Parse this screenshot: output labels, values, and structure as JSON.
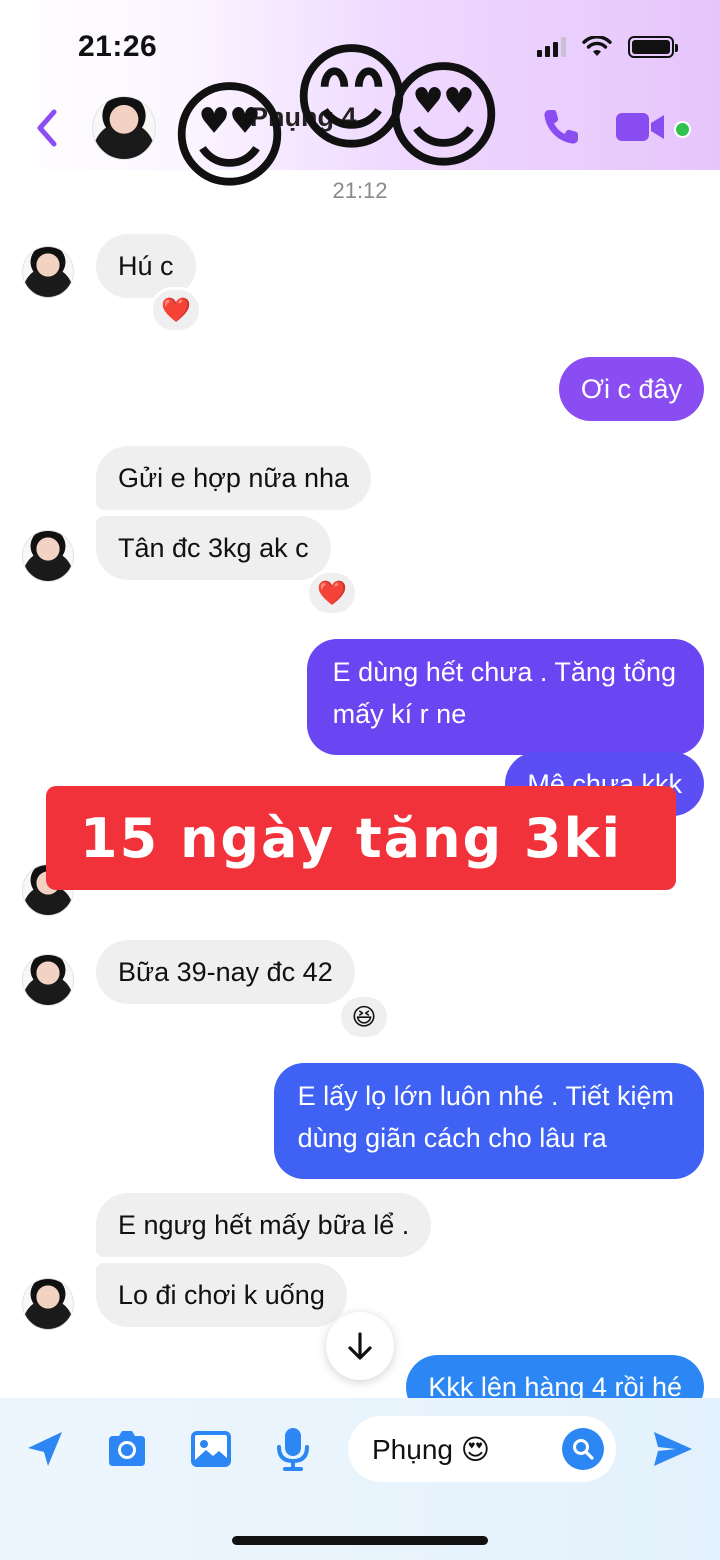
{
  "status_bar": {
    "time": "21:26",
    "icons": [
      "signal-icon",
      "wifi-icon",
      "battery-icon"
    ]
  },
  "header": {
    "contact_name": "Phụng 4",
    "contact_status": "",
    "icons": [
      "back-icon",
      "avatar",
      "phone-icon",
      "video-camera-icon"
    ],
    "online": true,
    "stickers": [
      "😍",
      "😊",
      "😍"
    ]
  },
  "timestamp": "21:12",
  "messages": [
    {
      "from": "them",
      "text": "Hú c",
      "reaction": "❤️"
    },
    {
      "from": "me",
      "text": "Ơi c đây"
    },
    {
      "from": "them",
      "text": "Gửi e hợp nữa nha"
    },
    {
      "from": "them",
      "text": "Tân đc 3kg ak c",
      "reaction": "❤️"
    },
    {
      "from": "me",
      "text_line1": "E dùng hết chưa . Tăng tổng",
      "text_line2": "mấy kí r ne"
    },
    {
      "from": "me",
      "text": "Mê chưa kkk"
    },
    {
      "from": "them",
      "text": "🤣"
    },
    {
      "from": "them",
      "text": "Bữa 39-nay đc 42",
      "reaction": "😆"
    },
    {
      "from": "me",
      "text_line1": "E lấy lọ lớn luôn nhé . Tiết kiệm",
      "text_line2": "dùng giãn cách cho lâu ra"
    },
    {
      "from": "them",
      "text": "E ngưg hết mấy bữa lể ."
    },
    {
      "from": "them",
      "text": "Lo đi chơi k uống"
    },
    {
      "from": "me",
      "text": "Kkk lên hàng 4 rồi hé"
    }
  ],
  "promo_banner": "15 ngày tăng 3ki",
  "composer": {
    "input_value": "Phụng 😍",
    "icons": [
      "location-arrow-icon",
      "camera-icon",
      "gallery-icon",
      "microphone-icon",
      "search-icon",
      "send-icon"
    ]
  },
  "colors": {
    "accent_purple": "#8a4df2",
    "accent_blue": "#2c87f4",
    "incoming_bubble": "#efefef",
    "banner_red": "#f2323a"
  }
}
